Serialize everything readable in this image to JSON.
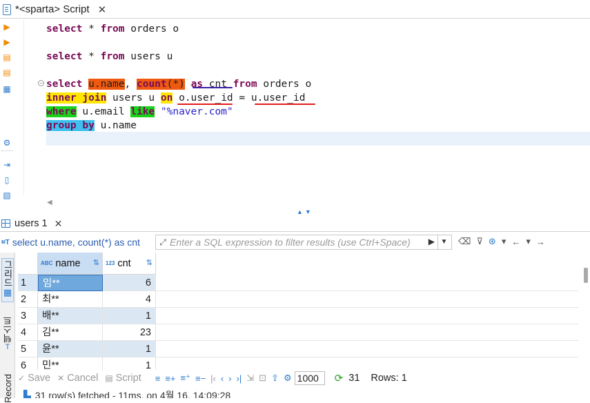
{
  "editor_tab": {
    "title": "*<sparta> Script",
    "close": "✕"
  },
  "editor": {
    "line1": [
      "select",
      " * ",
      "from",
      " orders o"
    ],
    "line2": [
      "select",
      " * ",
      "from",
      " users u"
    ],
    "line3": {
      "kw_select": "select",
      "u_name": "u.name",
      "comma": ", ",
      "count": "count",
      "paren": "(*)",
      "as": "as",
      "cnt": " cnt ",
      "from": "from",
      "rest": " orders o"
    },
    "line4": {
      "inner_join": "inner join",
      "mid": " users u ",
      "on": "on",
      "cond1": " o.user_id",
      "eq": " = ",
      "cond2": "u.user_id"
    },
    "line5": {
      "where": "where",
      "mid": " u.email ",
      "like": "like",
      "str": " \"%naver.com\""
    },
    "line6": {
      "group_by": "group by",
      "rest": " u.name"
    }
  },
  "results_tab": {
    "title": "users 1",
    "close": "✕"
  },
  "filter": {
    "query_text": "select u.name, count(*) as cnt",
    "placeholder": "Enter a SQL expression to filter results (use Ctrl+Space)"
  },
  "side_tabs": {
    "grid": "그리드",
    "text": "텍스트",
    "record": "Record"
  },
  "grid": {
    "columns": [
      {
        "type": "ABC",
        "name": "name"
      },
      {
        "type": "123",
        "name": "cnt"
      }
    ],
    "rows": [
      {
        "n": "1",
        "name": "임**",
        "cnt": "6"
      },
      {
        "n": "2",
        "name": "최**",
        "cnt": "4"
      },
      {
        "n": "3",
        "name": "배**",
        "cnt": "1"
      },
      {
        "n": "4",
        "name": "김**",
        "cnt": "23"
      },
      {
        "n": "5",
        "name": "윤**",
        "cnt": "1"
      },
      {
        "n": "6",
        "name": "민**",
        "cnt": "1"
      }
    ]
  },
  "toolbar": {
    "save": "Save",
    "cancel": "Cancel",
    "script": "Script",
    "limit": "1000",
    "fetched_count": "31",
    "rows": "Rows: 1"
  },
  "status": {
    "text": "31 row(s) fetched - 11ms, on 4월 16, 14:09:28"
  },
  "colors": {
    "accent": "#2e7bcf",
    "keyword": "#7a0a55",
    "string": "#2a22c9",
    "selection": "#6fa8dc"
  }
}
